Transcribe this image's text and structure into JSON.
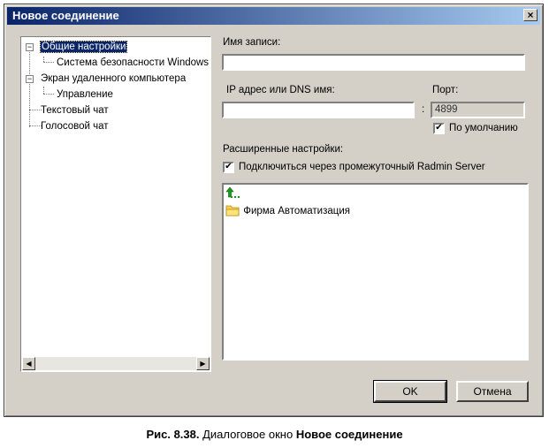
{
  "window": {
    "title": "Новое соединение",
    "close_glyph": "×"
  },
  "tree": {
    "items": [
      {
        "label": "Общие настройки",
        "expander": "−"
      },
      {
        "label": "Система безопасности Windows"
      },
      {
        "label": "Экран удаленного компьютера",
        "expander": "−"
      },
      {
        "label": "Управление"
      },
      {
        "label": "Текстовый чат"
      },
      {
        "label": "Голосовой чат"
      }
    ],
    "scroll_left": "◀",
    "scroll_right": "▶"
  },
  "form": {
    "record_name_label": "Имя записи:",
    "record_name_value": "",
    "ip_label": "IP адрес или DNS имя:",
    "ip_value": "",
    "separator": ":",
    "port_label": "Порт:",
    "port_value": "4899",
    "default_checkbox_label": "По умолчанию",
    "default_checked": true,
    "advanced_label": "Расширенные настройки:",
    "via_server_label": "Подключиться через промежуточный Radmin Server",
    "via_server_checked": true,
    "check_glyph": "✔"
  },
  "server_list": {
    "items": [
      {
        "label": "",
        "icon": "up-level-icon"
      },
      {
        "label": "Фирма Автоматизация",
        "icon": "folder-icon"
      }
    ]
  },
  "buttons": {
    "ok": "OK",
    "cancel": "Отмена"
  },
  "caption": {
    "prefix": "Рис. 8.38.",
    "text": " Диалоговое окно ",
    "name": "Новое соединение"
  },
  "colors": {
    "title_start": "#0a246a",
    "title_end": "#a6caf0",
    "face": "#d4d0c8",
    "selection": "#0a246a"
  }
}
